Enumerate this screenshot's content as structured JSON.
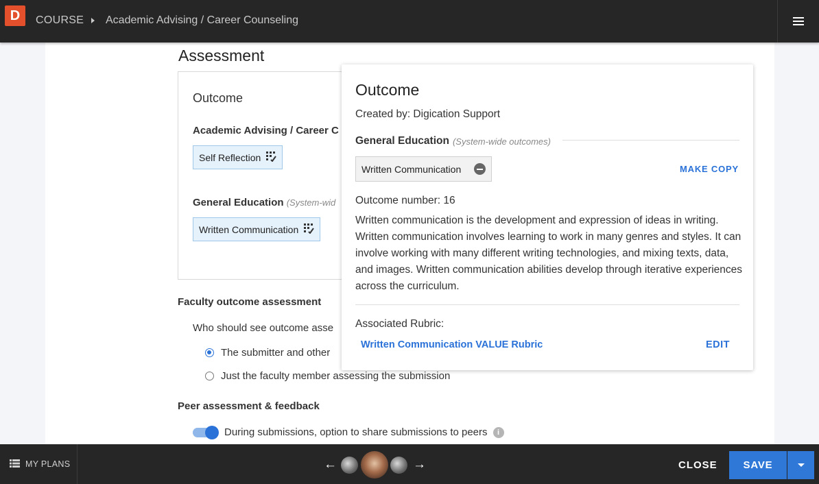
{
  "header": {
    "logo_letter": "D",
    "course_label": "COURSE",
    "course_title": "Academic Advising / Career Counseling"
  },
  "assessment": {
    "title": "Assessment",
    "outcome_box": {
      "title": "Outcome",
      "group1_title": "Academic Advising / Career C",
      "group1_chip": "Self Reflection",
      "group2_title": "General Education",
      "group2_sub": "(System-wid",
      "group2_chip": "Written Communication"
    },
    "faculty": {
      "title": "Faculty outcome assessment",
      "question": "Who should see outcome asse",
      "option1": "The submitter and other",
      "option2": "Just the faculty member assessing the submission",
      "selected": 1
    },
    "peer": {
      "title": "Peer assessment & feedback",
      "toggle_label": "During submissions, option to share submissions to peers",
      "toggle_on": true
    }
  },
  "popover": {
    "title": "Outcome",
    "created_by": "Created by: Digication Support",
    "group_title": "General Education",
    "group_sub": "(System-wide outcomes)",
    "chip": "Written Communication",
    "make_copy": "MAKE COPY",
    "outcome_number": "Outcome number: 16",
    "description": "Written communication is the development and expression of ideas in writing. Written communication involves learning to work in many genres and styles. It can involve working with many different writing technologies, and mixing texts, data, and images. Written communication abilities develop through iterative experiences across the curriculum.",
    "rubric_label": "Associated Rubric:",
    "rubric_link": "Written Communication VALUE Rubric",
    "edit": "EDIT"
  },
  "footer": {
    "my_plans": "MY PLANS",
    "close": "CLOSE",
    "save": "SAVE"
  },
  "colors": {
    "accent": "#2f78d8",
    "logo": "#e4502b",
    "bar": "#262626"
  }
}
